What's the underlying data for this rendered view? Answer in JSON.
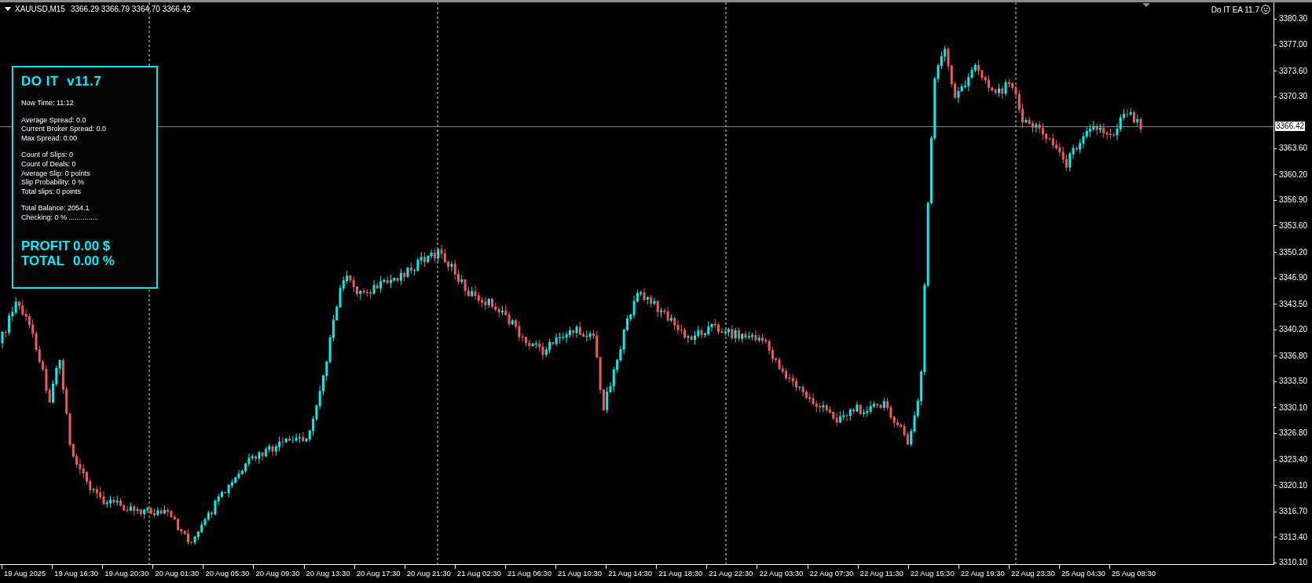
{
  "chart": {
    "symbol": "XAUUSD,M15",
    "ohlc": "3366.29 3366.79 3364.70 3366.42",
    "expert_label": "Do IT EA 11.7",
    "current_price": "3366.42"
  },
  "panel": {
    "title": "DO IT  v11.7",
    "groups": [
      [
        "Now Time: 11:12"
      ],
      [
        "Average Spread: 0.0",
        "Current Broker Spread: 0.0",
        "Max Spread: 0.00"
      ],
      [
        "Count of Slips: 0",
        "Count of Deals: 0",
        "Average Slip: 0 points",
        "Slip Probability: 0 %",
        "Total slips: 0 points"
      ],
      [
        "Total Balance: 2054.1",
        "Checking: 0 % ..............."
      ]
    ],
    "totals": [
      {
        "label": "PROFIT",
        "value": "0.00 $"
      },
      {
        "label": "TOTAL",
        "value": "0.00 %"
      }
    ]
  },
  "price_axis": [
    "3380.30",
    "3377.00",
    "3373.60",
    "3370.30",
    "3363.60",
    "3360.20",
    "3356.90",
    "3353.60",
    "3350.20",
    "3346.90",
    "3343.50",
    "3340.20",
    "3336.80",
    "3333.50",
    "3330.10",
    "3326.80",
    "3323.40",
    "3320.10",
    "3316.70",
    "3313.40",
    "3310.10"
  ],
  "time_axis": [
    "19 Aug 2025",
    "19 Aug 16:30",
    "19 Aug 20:30",
    "20 Aug 01:30",
    "20 Aug 05:30",
    "20 Aug 09:30",
    "20 Aug 13:30",
    "20 Aug 17:30",
    "20 Aug 21:30",
    "21 Aug 02:30",
    "21 Aug 06:30",
    "21 Aug 10:30",
    "21 Aug 14:30",
    "21 Aug 18:30",
    "21 Aug 22:30",
    "22 Aug 03:30",
    "22 Aug 07:30",
    "22 Aug 11:30",
    "22 Aug 15:30",
    "22 Aug 19:30",
    "22 Aug 23:30",
    "25 Aug 04:30",
    "25 Aug 08:30"
  ]
}
